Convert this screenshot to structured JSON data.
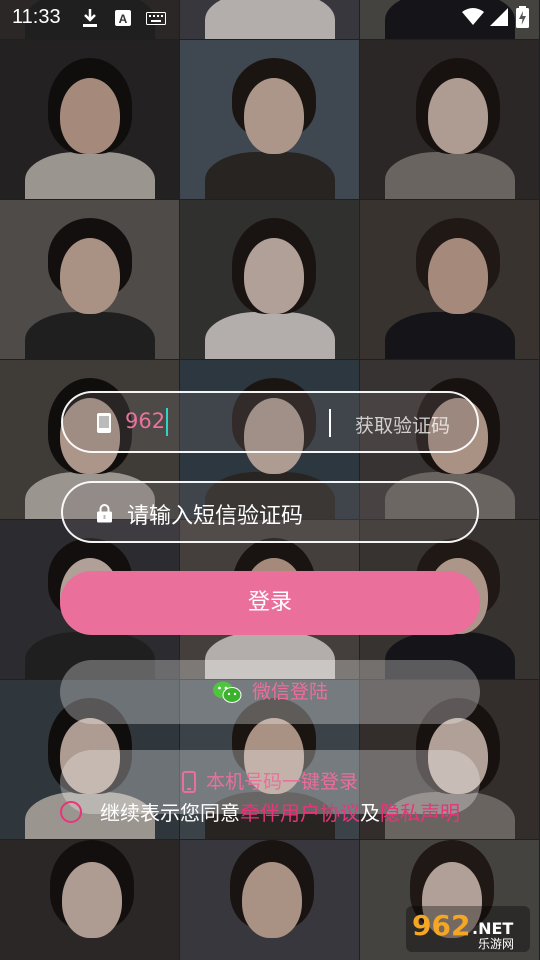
{
  "status_bar": {
    "time": "11:33",
    "icons": [
      "download-icon",
      "font-a-icon",
      "keyboard-icon",
      "wifi-icon",
      "signal-icon",
      "battery-icon"
    ]
  },
  "login": {
    "phone_value": "962",
    "get_code_label": "获取验证码",
    "sms_code_placeholder": "请输入短信验证码",
    "login_label": "登录",
    "wechat_login_label": "微信登陆",
    "one_click_label": "本机号码一键登录",
    "agreement_prefix": "继续表示您同意",
    "user_agreement_label": "牵伴用户协议",
    "conjunction": "及",
    "privacy_label": "隐私声明"
  },
  "watermark": {
    "number": "962",
    "suffix": ".NET",
    "subtitle": "乐游网"
  },
  "colors": {
    "accent": "#ea6f9a",
    "link": "#e6357a",
    "cursor": "#2fd3c8"
  }
}
